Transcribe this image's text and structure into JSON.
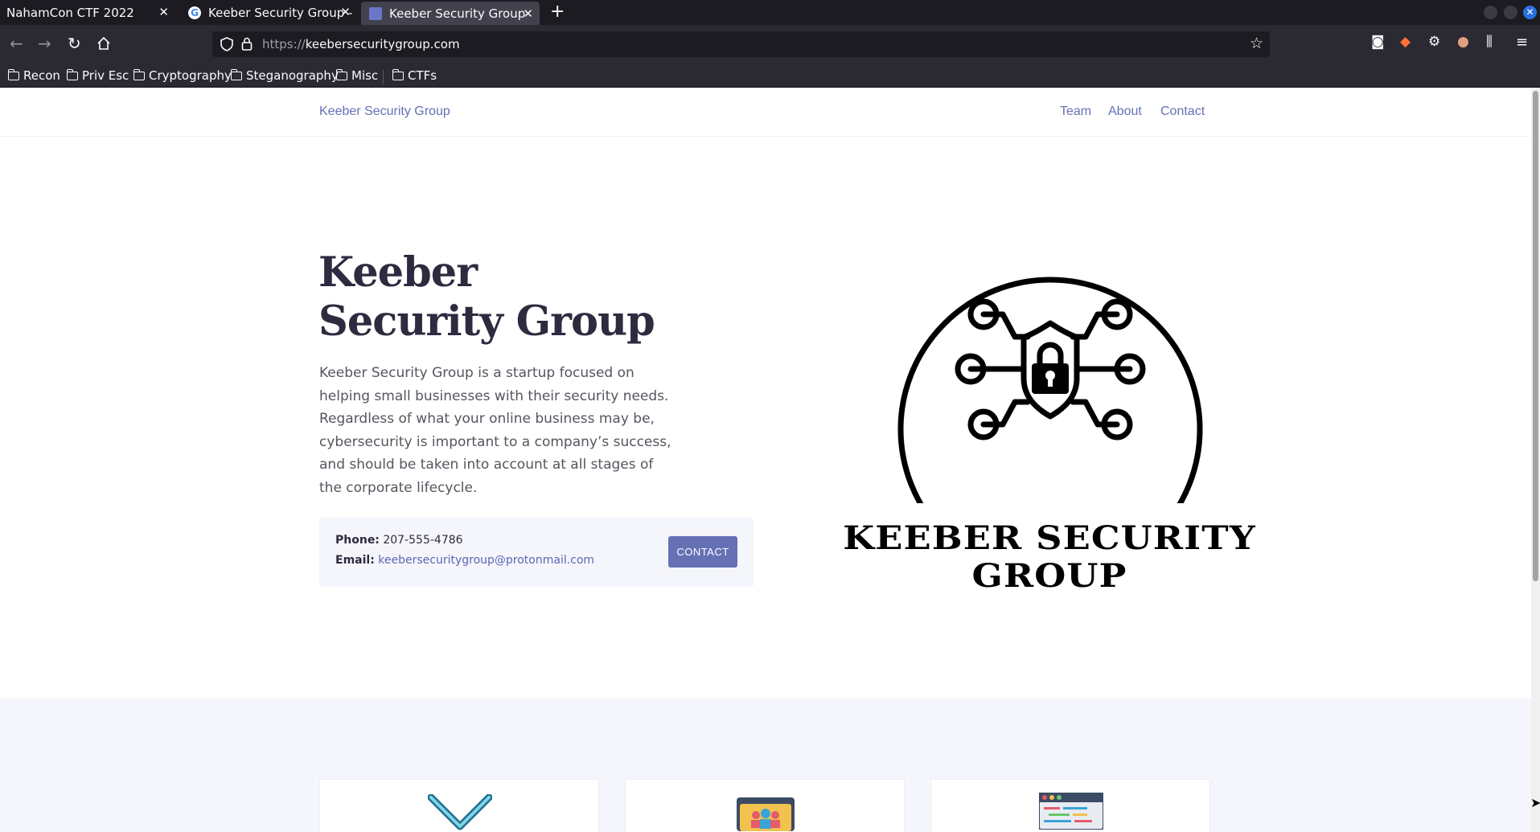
{
  "browser": {
    "tabs": [
      {
        "title": "NahamCon CTF 2022"
      },
      {
        "title": "Keeber Security Group - G"
      },
      {
        "title": "Keeber Security Group"
      }
    ],
    "url": {
      "protocol": "https://",
      "host": "keebersecuritygroup.com"
    },
    "bookmarks": [
      "Recon",
      "Priv Esc",
      "Cryptography",
      "Steganography",
      "Misc",
      "CTFs"
    ]
  },
  "site": {
    "brand": "Keeber Security Group",
    "nav": [
      "Team",
      "About",
      "Contact"
    ],
    "hero": {
      "title": "Keeber Security Group",
      "description": "Keeber Security Group is a startup focused on helping small businesses with their security needs. Regardless of what your online business may be, cybersecurity is important to a company’s success, and should be taken into account at all stages of the corporate lifecycle."
    },
    "contact": {
      "phone_label": "Phone:",
      "phone": "207-555-4786",
      "email_label": "Email:",
      "email": "keebersecuritygroup@protonmail.com",
      "button": "CONTACT"
    },
    "logo_text": "KEEBER SECURITY GROUP"
  },
  "colors": {
    "accent": "#6670b5",
    "heading": "#2d2b3f",
    "panel": "#f5f6fb"
  },
  "icons": [
    "google-favicon",
    "keeber-favicon",
    "back-arrow-icon",
    "forward-arrow-icon",
    "reload-icon",
    "home-icon",
    "shield-icon",
    "lock-icon",
    "star-icon",
    "pocket-icon",
    "extension-icon",
    "menu-icon"
  ]
}
